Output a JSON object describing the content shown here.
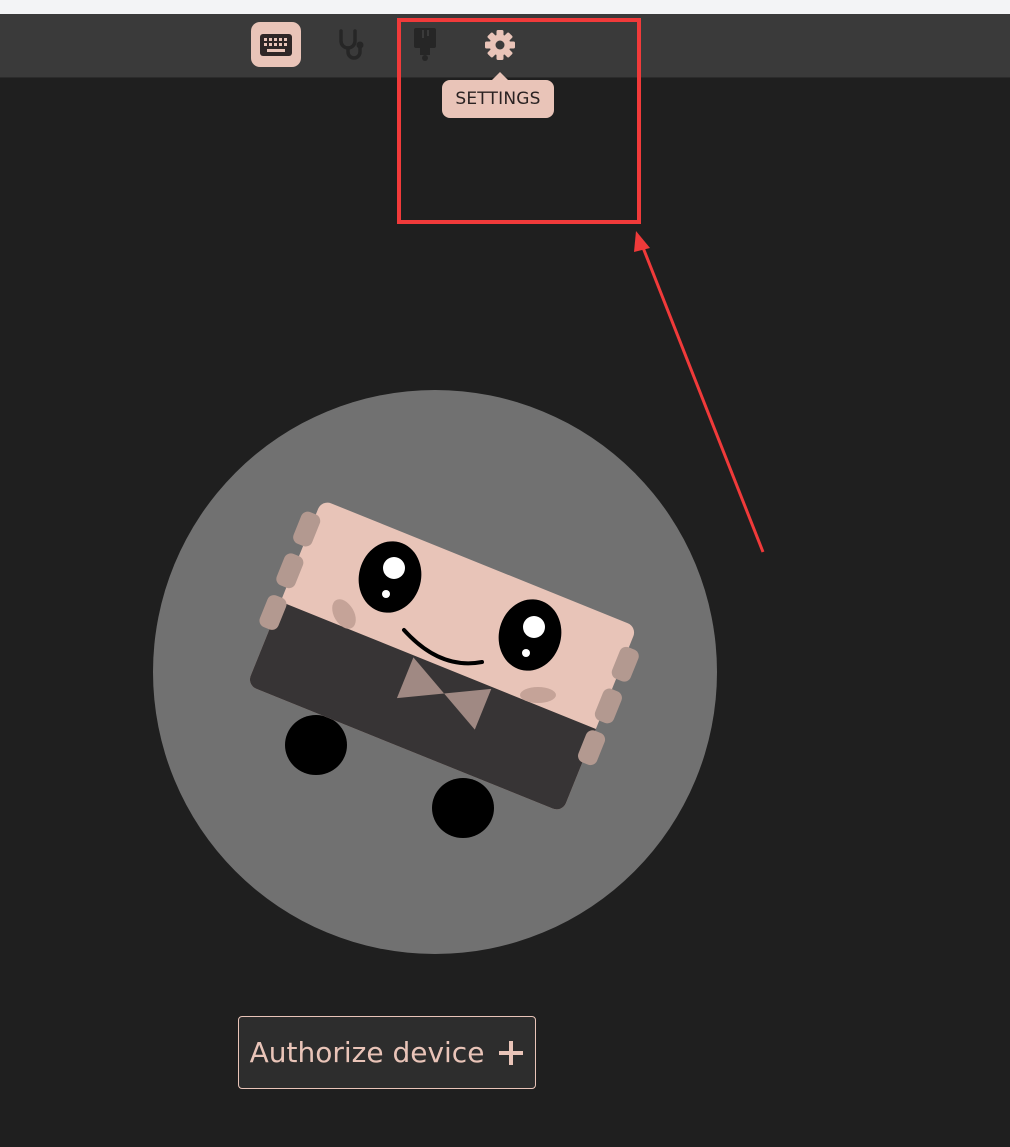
{
  "toolbar": {
    "tools": [
      {
        "name": "keyboard-icon",
        "active": true
      },
      {
        "name": "stethoscope-icon",
        "active": false
      },
      {
        "name": "paint-brush-icon",
        "active": false
      },
      {
        "name": "gear-icon",
        "active": false
      }
    ]
  },
  "tooltip": {
    "label": "SETTINGS"
  },
  "main": {
    "authorize_label": "Authorize device",
    "authorize_icon": "plus-icon"
  },
  "colors": {
    "accent": "#e9c4b8",
    "toolbar_bg": "#3a3a3a",
    "page_bg": "#1f1f1f",
    "annotation": "#f03a3a"
  }
}
